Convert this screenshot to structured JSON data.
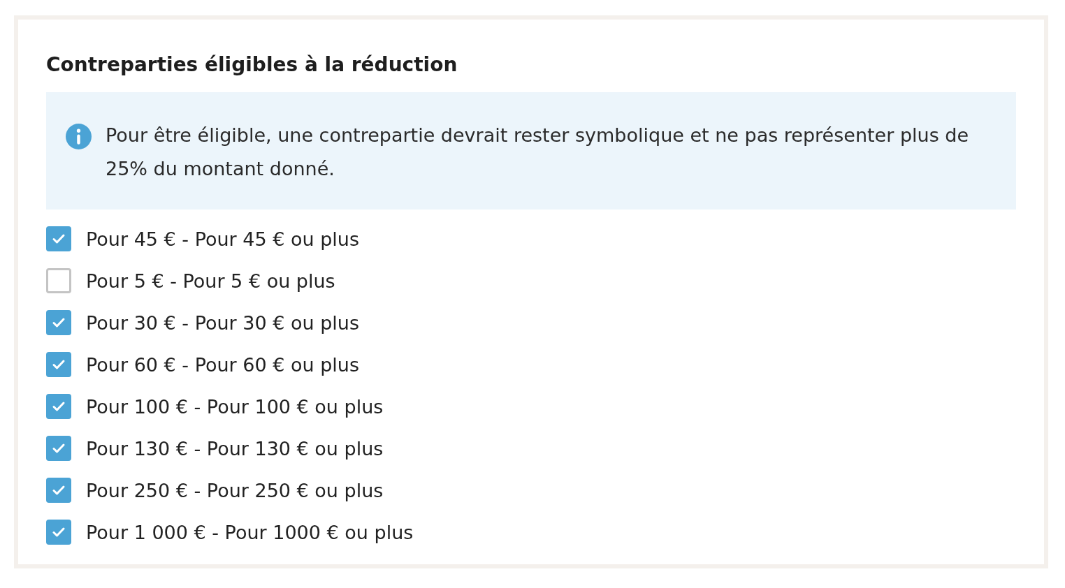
{
  "title": "Contreparties éligibles à la réduction",
  "notice": {
    "text": "Pour être éligible, une contrepartie devrait rester symbolique et ne pas représenter plus de 25% du montant donné."
  },
  "options": [
    {
      "label": "Pour 45 € - Pour 45 € ou plus",
      "checked": true
    },
    {
      "label": "Pour 5 € - Pour 5 € ou plus",
      "checked": false
    },
    {
      "label": "Pour 30 € - Pour 30 € ou plus",
      "checked": true
    },
    {
      "label": "Pour 60 € - Pour 60 € ou plus",
      "checked": true
    },
    {
      "label": "Pour 100 € - Pour 100 € ou plus",
      "checked": true
    },
    {
      "label": "Pour 130 € - Pour 130 € ou plus",
      "checked": true
    },
    {
      "label": "Pour 250 € - Pour 250 € ou plus",
      "checked": true
    },
    {
      "label": "Pour 1 000 € - Pour 1000 € ou plus",
      "checked": true
    }
  ]
}
